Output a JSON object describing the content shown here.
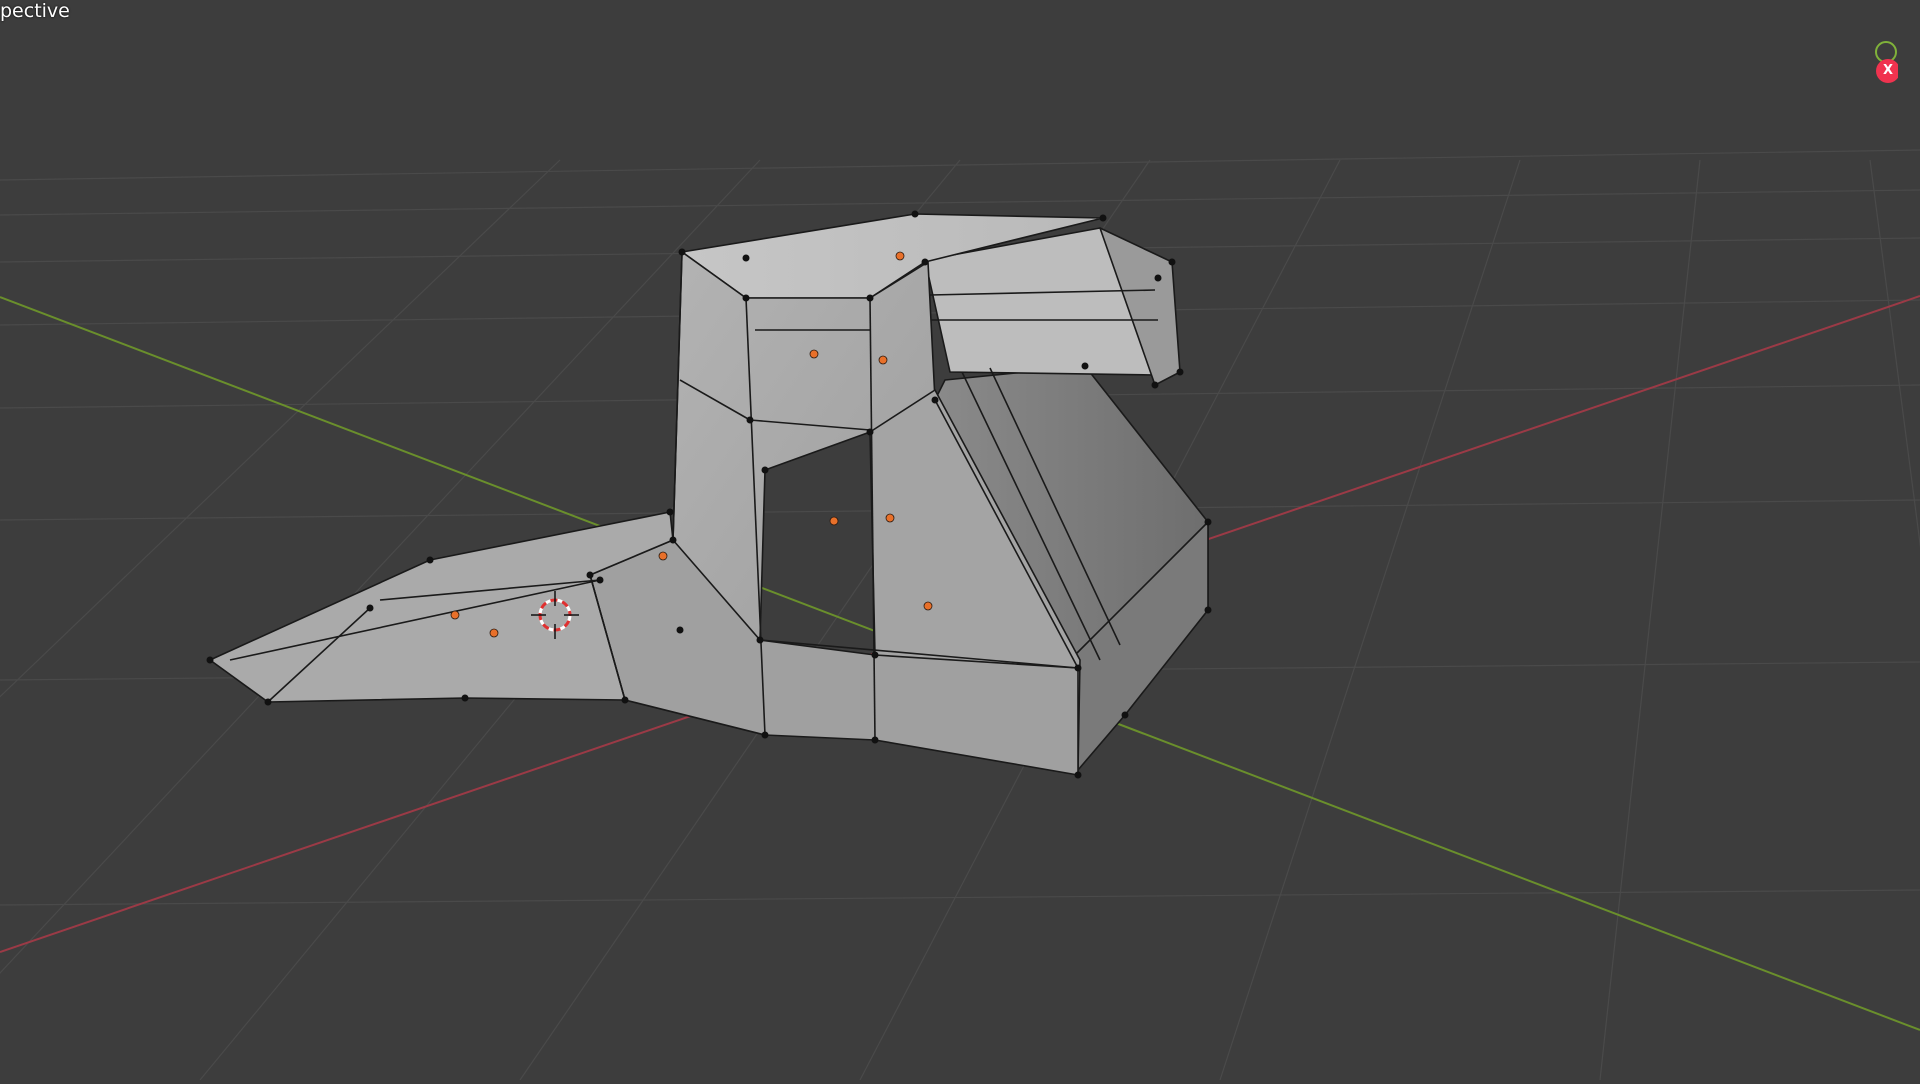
{
  "viewport": {
    "view_label": "pective",
    "background_color": "#3d3d3d",
    "grid_color": "#4a4a4a",
    "x_axis_color": "#9b3a46",
    "y_axis_color": "#6a8f2c",
    "mesh_face_color": "#a9a9a9",
    "vertex_color": "#111111",
    "face_dot_color": "#e8702a"
  },
  "gizmo": {
    "x_label": "X",
    "x_color": "#f0334f",
    "y_color": "#80b23a"
  },
  "cursor": {
    "icon": "3d-cursor-icon"
  }
}
